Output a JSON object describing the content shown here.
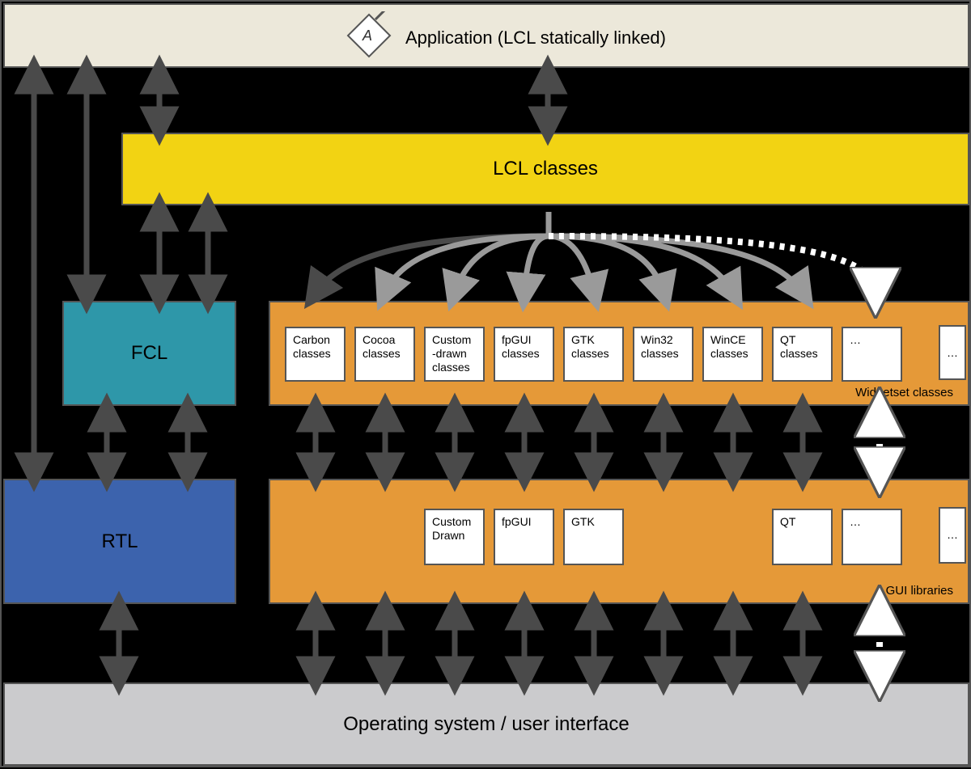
{
  "application": {
    "label": "Application (LCL   statically linked)"
  },
  "lcl": {
    "label": "LCL classes"
  },
  "fcl": {
    "label": "FCL"
  },
  "rtl": {
    "label": "RTL"
  },
  "widgetset": {
    "items": {
      "carbon": "Carbon\nclasses",
      "cocoa": "Cocoa\nclasses",
      "custom": "Custom\n-drawn\nclasses",
      "fpgui": "fpGUI\nclasses",
      "gtk": "GTK\nclasses",
      "win32": "Win32\nclasses",
      "wince": "WinCE\nclasses",
      "qt": "QT\nclasses",
      "more": "…"
    },
    "more_ellipsis": "…",
    "tag": "Widgetset   classes"
  },
  "gui": {
    "items": {
      "custom": "Custom\nDrawn",
      "fpgui": "fpGUI",
      "gtk": "GTK",
      "qt": "QT",
      "more": "…"
    },
    "more_ellipsis": "…",
    "tag": "GUI libraries"
  },
  "os": {
    "label": "Operating system / user interface"
  },
  "colors": {
    "app": "#ece8da",
    "lcl": "#f2d313",
    "fcl": "#2e97a9",
    "rtl": "#3c63ad",
    "ws": "#e59938",
    "gui": "#e59938",
    "os": "#cbcbcd"
  }
}
